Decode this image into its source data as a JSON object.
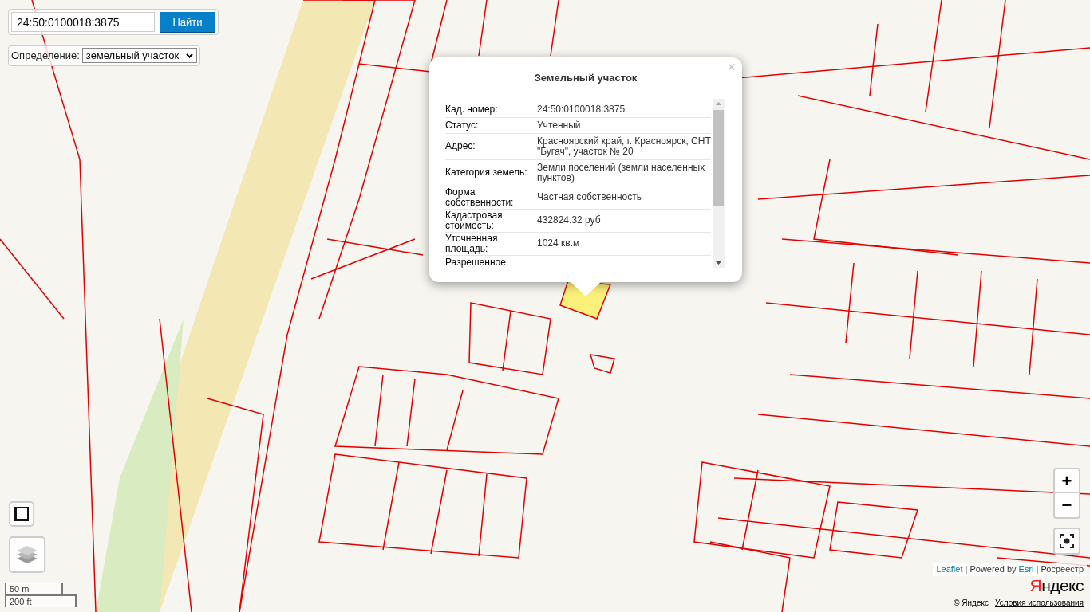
{
  "search": {
    "value": "24:50:0100018:3875",
    "button": "Найти"
  },
  "definition": {
    "label": "Определение:",
    "value": "земельный участок"
  },
  "popup": {
    "title": "Земельный участок",
    "close": "×",
    "rows": [
      {
        "label": "Кад. номер:",
        "value": "24:50:0100018:3875"
      },
      {
        "label": "Статус:",
        "value": "Учтенный"
      },
      {
        "label": "Адрес:",
        "value": "Красноярский край, г. Красноярск, СНТ \"Бугач\", участок № 20"
      },
      {
        "label": "Категория земель:",
        "value": "Земли поселений (земли населенных пунктов)"
      },
      {
        "label": "Форма собственности:",
        "value": "Частная собственность"
      },
      {
        "label": "Кадастровая стоимость:",
        "value": "432824.32 руб"
      },
      {
        "label": "Уточненная площадь:",
        "value": "1024 кв.м"
      },
      {
        "label": "Разрешенное"
      }
    ]
  },
  "zoom": {
    "in": "+",
    "out": "−"
  },
  "scale": {
    "metric": "50 m",
    "imperial": "200 ft"
  },
  "attribution": [
    {
      "text": "Leaflet",
      "kind": "link"
    },
    {
      "text": " | Powered by ",
      "kind": "text"
    },
    {
      "text": "Esri",
      "kind": "link"
    },
    {
      "text": " | Росреестр",
      "kind": "text"
    }
  ],
  "yandex": {
    "logo": "Яндекс",
    "copyright": "© Яндекс",
    "terms": "Условия использования"
  }
}
